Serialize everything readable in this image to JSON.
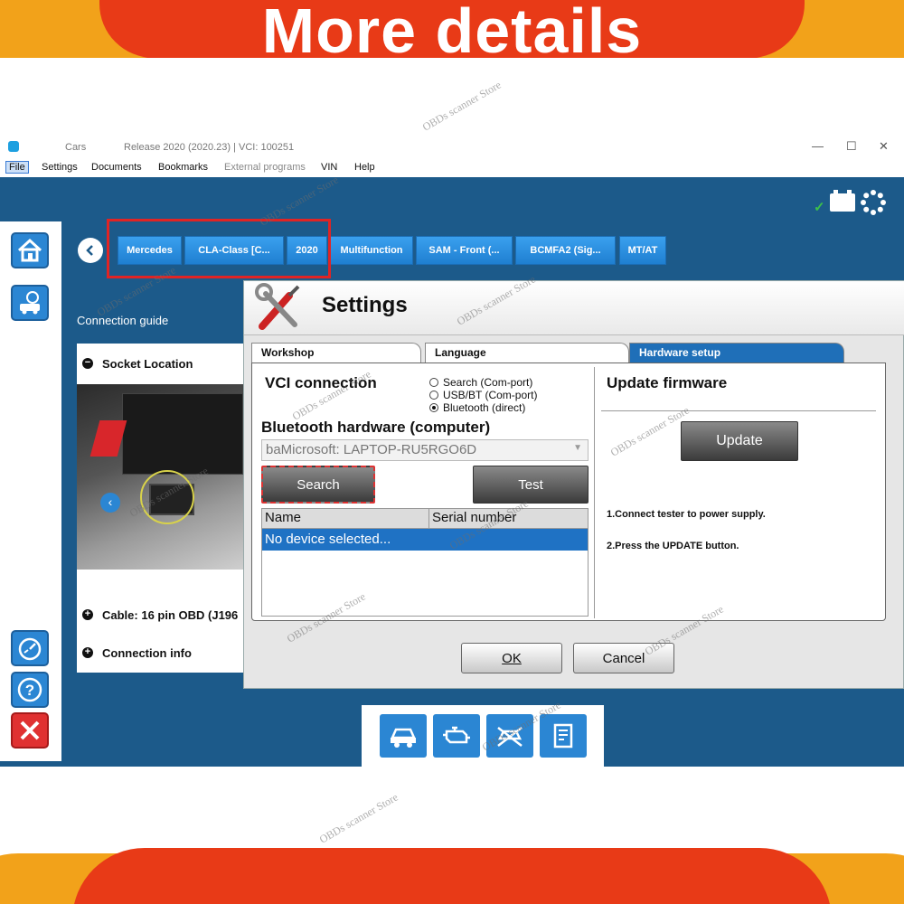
{
  "banner": {
    "title": "More details"
  },
  "titlebar": {
    "app": "Cars",
    "release": "Release 2020 (2020.23)  |  VCI: 100251",
    "minimize": "—",
    "maximize": "☐",
    "close": "✕"
  },
  "menu": [
    "File",
    "Settings",
    "Documents",
    "Bookmarks",
    "External programs",
    "VIN",
    "Help"
  ],
  "breadcrumbs": [
    "Mercedes",
    "CLA-Class [C...",
    "2020",
    "Multifunction",
    "SAM - Front (...",
    "BCMFA2 (Sig...",
    "MT/AT"
  ],
  "guide": {
    "title": "Connection guide",
    "socket": "Socket Location",
    "cable": "Cable: 16 pin OBD (J196",
    "info": "Connection info"
  },
  "dialog": {
    "title": "Settings",
    "tabs": [
      "Workshop",
      "Language",
      "Hardware setup"
    ],
    "vci_title": "VCI connection",
    "radios": [
      {
        "label": "Search (Com-port)",
        "selected": false
      },
      {
        "label": "USB/BT (Com-port)",
        "selected": false
      },
      {
        "label": "Bluetooth (direct)",
        "selected": true
      }
    ],
    "bt_title": "Bluetooth hardware (computer)",
    "bt_value": "baMicrosoft: LAPTOP-RU5RGO6D",
    "search_btn": "Search",
    "test_btn": "Test",
    "table": {
      "col_name": "Name",
      "col_serial": "Serial number",
      "row": "No device selected..."
    },
    "fw_title": "Update firmware",
    "update_btn": "Update",
    "note1": "1.Connect tester to power supply.",
    "note2": "2.Press the UPDATE button.",
    "ok": "OK",
    "cancel": "Cancel"
  },
  "watermark": "OBDs scanner Store",
  "colors": {
    "accent": "#1f72c4",
    "app_bg": "#1c5a8a",
    "banner_red": "#e83a17",
    "banner_orange": "#f2a21a",
    "highlight": "#e02424"
  }
}
